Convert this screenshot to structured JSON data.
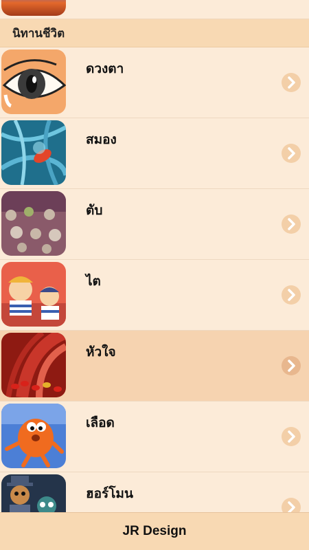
{
  "section": {
    "title": "นิทานชีวิต"
  },
  "items": [
    {
      "label": "ดวงตา",
      "icon": "eye-cartoon-icon"
    },
    {
      "label": "สมอง",
      "icon": "brain-neuron-icon"
    },
    {
      "label": "ตับ",
      "icon": "liver-cells-icon"
    },
    {
      "label": "ไต",
      "icon": "kidney-cartoon-icon"
    },
    {
      "label": "หัวใจ",
      "icon": "heart-vessel-icon",
      "selected": true
    },
    {
      "label": "เลือด",
      "icon": "blood-cell-character-icon"
    },
    {
      "label": "ฮอร์โมน",
      "icon": "hormone-characters-icon"
    }
  ],
  "footer": {
    "label": "JR Design"
  },
  "colors": {
    "background": "#fcebd8",
    "header": "#f8d9b3",
    "selected_row": "#f6d3b0",
    "chevron": "#f3cfa8"
  }
}
